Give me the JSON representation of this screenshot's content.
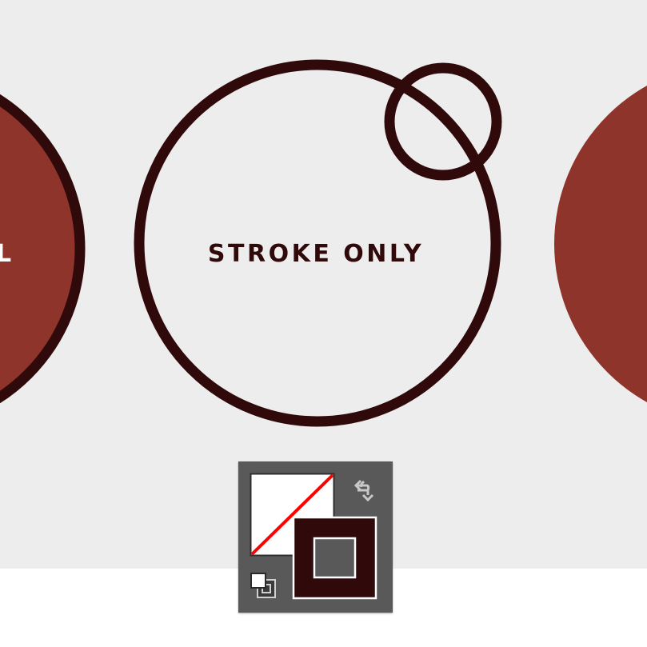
{
  "canvas": {
    "background": "#eeeded",
    "stroke_color": "#300a0a",
    "fill_color": "#8f342b",
    "left_circle": {
      "label": "FILL",
      "visible_label": "L",
      "style": "fill-and-stroke"
    },
    "center_circle": {
      "label": "STROKE ONLY",
      "style": "stroke-only"
    },
    "right_circle": {
      "style": "fill-only"
    },
    "selection_indicator": {
      "icon": "small-circle-overlay-icon"
    }
  },
  "fill_stroke_panel": {
    "fill_swatch": {
      "state": "none",
      "icon": "no-fill-swatch-icon",
      "slash_color": "#ff0000"
    },
    "stroke_swatch": {
      "color": "#300a0a",
      "icon": "stroke-swatch-icon"
    },
    "swap_icon": "swap-arrows-icon",
    "default_icon": "default-fill-stroke-icon"
  }
}
